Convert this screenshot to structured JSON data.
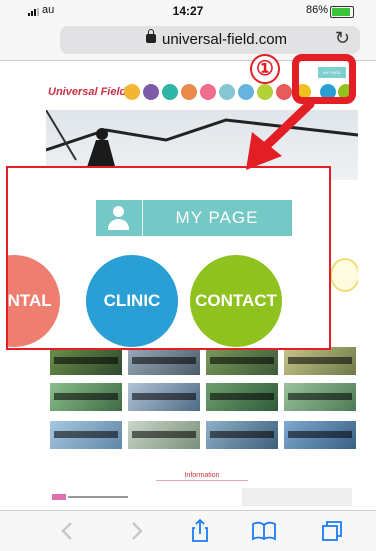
{
  "status_bar": {
    "carrier": "au",
    "time": "14:27",
    "battery_percent": "86%"
  },
  "browser": {
    "url": "universal-field.com"
  },
  "site": {
    "logo": "Universal Field",
    "mini_mypage": "MY PAGE",
    "info_title": "Information",
    "nav_dot_colors": [
      "#f2b632",
      "#7f5aa8",
      "#2fb5a6",
      "#e98a4a",
      "#f06c8c",
      "#86c6d2",
      "#66b3e0",
      "#b2d235",
      "#e65c5c",
      "#f0c020"
    ]
  },
  "callout": {
    "mypage_label": "MY PAGE",
    "rental_label": "ENTAL",
    "clinic_label": "CLINIC",
    "contact_label": "CONTACT"
  },
  "annotation": {
    "number": "①",
    "accent_color": "#e31e24"
  }
}
